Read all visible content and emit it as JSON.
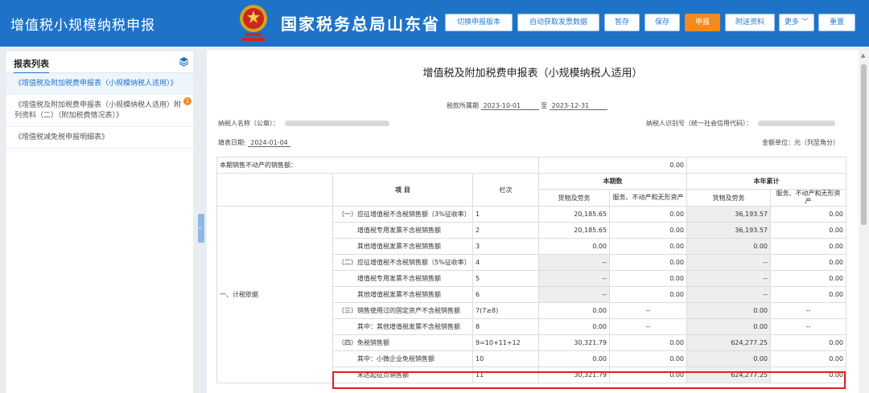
{
  "app_title": "增值税小规模纳税申报",
  "bureau_name": "国家税务总局山东省电子税务局",
  "toolbar": {
    "switch_version": "切换申报版本",
    "auto_fetch": "自动获取发票数据",
    "stage": "暂存",
    "save": "保存",
    "submit": "申报",
    "attach": "附送资料",
    "more": "更多",
    "reset": "重置"
  },
  "sidebar": {
    "title": "报表列表",
    "items": [
      {
        "label": "《增值税及附加税费申报表（小规模纳税人适用）》"
      },
      {
        "label": "《增值税及附加税费申报表（小规模纳税人适用）附列资料（二）（附加税费情况表）》",
        "badge": "1"
      },
      {
        "label": "《增值税减免税申报明细表》"
      }
    ]
  },
  "form": {
    "title": "增值税及附加税费申报表（小规模纳税人适用）",
    "period_label": "税款所属期",
    "period_from": "2023-10-01",
    "period_sep": "至",
    "period_to": "2023-12-31",
    "taxpayer_label": "纳税人名称（公章）：",
    "taxid_label": "纳税人识别号（统一社会信用代码）：",
    "fill_date_label": "填表日期:",
    "fill_date": "2024-01-04",
    "unit": "金额单位：元（列至角分）",
    "property_sales_label": "本期销售不动产的销售额：",
    "property_sales_value": "0.00",
    "headers": {
      "item": "项  目",
      "col": "栏次",
      "current": "本期数",
      "ytd": "本年累计",
      "goods": "货物及劳务",
      "services": "服务、不动产和无形资产"
    },
    "section_label": "一、计税依据",
    "rows": [
      {
        "item": "（一）应征增值税不含税销售额（3%征收率）",
        "col": "1",
        "c_goods": "20,185.65",
        "c_serv": "0.00",
        "y_goods": "36,193.57",
        "y_serv": "0.00"
      },
      {
        "item": "增值税专用发票不含税销售额",
        "col": "2",
        "c_goods": "20,185.65",
        "c_serv": "0.00",
        "y_goods": "36,193.57",
        "y_serv": "0.00"
      },
      {
        "item": "其他增值税发票不含税销售额",
        "col": "3",
        "c_goods": "0.00",
        "c_serv": "0.00",
        "y_goods": "0.00",
        "y_serv": "0.00"
      },
      {
        "item": "（二）应征增值税不含税销售额（5%征收率）",
        "col": "4",
        "c_goods": "--",
        "c_serv": "0.00",
        "y_goods": "--",
        "y_serv": "0.00"
      },
      {
        "item": "增值税专用发票不含税销售额",
        "col": "5",
        "c_goods": "--",
        "c_serv": "0.00",
        "y_goods": "--",
        "y_serv": "0.00"
      },
      {
        "item": "其他增值税发票不含税销售额",
        "col": "6",
        "c_goods": "--",
        "c_serv": "0.00",
        "y_goods": "--",
        "y_serv": "0.00"
      },
      {
        "item": "（三）销售使用过的固定资产不含税销售额",
        "col": "7(7≥8)",
        "c_goods": "0.00",
        "c_serv": "--",
        "y_goods": "0.00",
        "y_serv": "--"
      },
      {
        "item": "其中：其他增值税发票不含税销售额",
        "col": "8",
        "c_goods": "0.00",
        "c_serv": "--",
        "y_goods": "0.00",
        "y_serv": "--"
      },
      {
        "item": "（四）免税销售额",
        "col": "9=10+11+12",
        "c_goods": "30,321.79",
        "c_serv": "0.00",
        "y_goods": "624,277.25",
        "y_serv": "0.00"
      },
      {
        "item": "其中：小微企业免税销售额",
        "col": "10",
        "c_goods": "0.00",
        "c_serv": "0.00",
        "y_goods": "0.00",
        "y_serv": "0.00"
      },
      {
        "item": "未达起征点销售额",
        "col": "11",
        "c_goods": "30,321.79",
        "c_serv": "0.00",
        "y_goods": "624,277.25",
        "y_serv": "0.00"
      }
    ]
  }
}
